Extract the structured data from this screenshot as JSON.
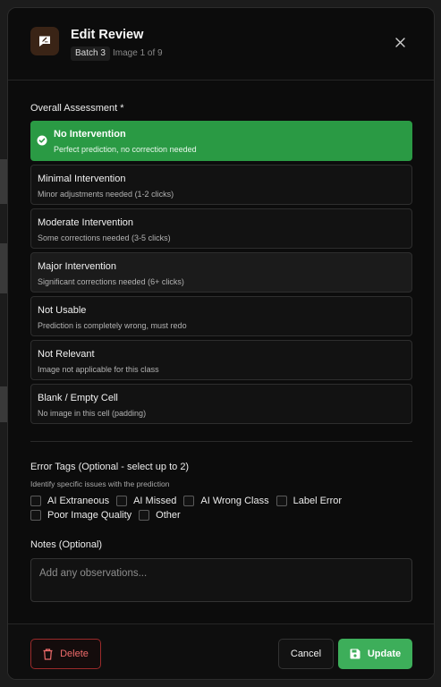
{
  "header": {
    "title": "Edit Review",
    "batch": "Batch 3",
    "image_counter": "Image 1 of 9",
    "accent_color": "#3a2416"
  },
  "assessment": {
    "label": "Overall Assessment *",
    "selected_color": "#2a9a44",
    "options": [
      {
        "title": "No Intervention",
        "desc": "Perfect prediction, no correction needed",
        "selected": true
      },
      {
        "title": "Minimal Intervention",
        "desc": "Minor adjustments needed (1-2 clicks)"
      },
      {
        "title": "Moderate Intervention",
        "desc": "Some corrections needed (3-5 clicks)"
      },
      {
        "title": "Major Intervention",
        "desc": "Significant corrections needed (6+ clicks)"
      },
      {
        "title": "Not Usable",
        "desc": "Prediction is completely wrong, must redo"
      },
      {
        "title": "Not Relevant",
        "desc": "Image not applicable for this class"
      },
      {
        "title": "Blank / Empty Cell",
        "desc": "No image in this cell (padding)"
      }
    ]
  },
  "error_tags": {
    "label": "Error Tags (Optional - select up to 2)",
    "hint": "Identify specific issues with the prediction",
    "tags": [
      "AI Extraneous",
      "AI Missed",
      "AI Wrong Class",
      "Label Error",
      "Poor Image Quality",
      "Other"
    ]
  },
  "notes": {
    "label": "Notes (Optional)",
    "placeholder": "Add any observations..."
  },
  "footer": {
    "delete_label": "Delete",
    "cancel_label": "Cancel",
    "update_label": "Update",
    "delete_color": "#ef6b6b",
    "update_color": "#3dae5a"
  }
}
